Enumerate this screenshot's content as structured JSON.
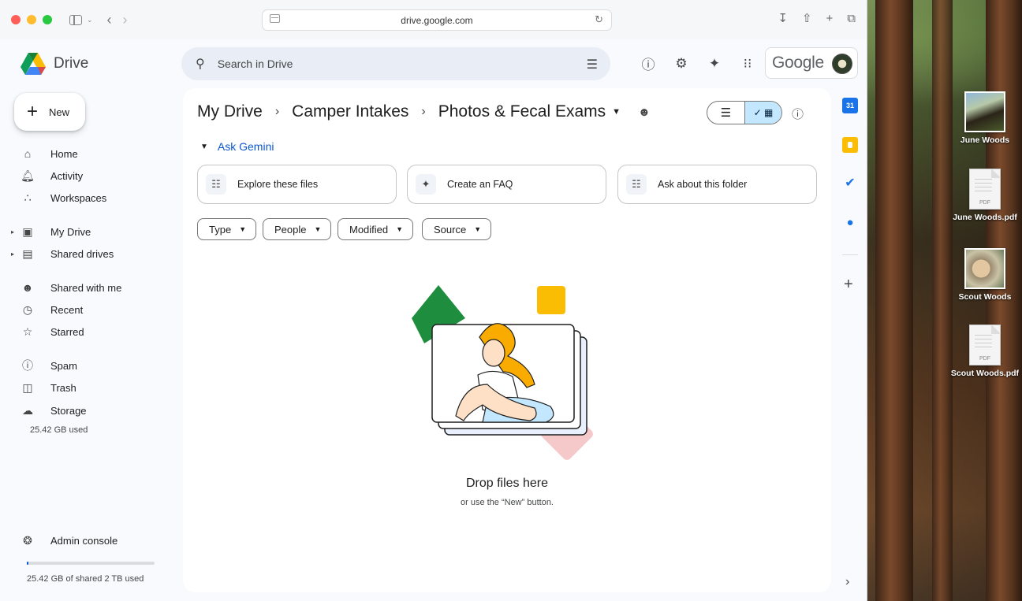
{
  "browser": {
    "url": "drive.google.com"
  },
  "header": {
    "app_name": "Drive",
    "search_placeholder": "Search in Drive",
    "google_word": "Google"
  },
  "leftnav": {
    "new_label": "New",
    "items_group1": [
      {
        "label": "Home",
        "icon": "home-icon"
      },
      {
        "label": "Activity",
        "icon": "bell-icon"
      },
      {
        "label": "Workspaces",
        "icon": "workspaces-icon"
      }
    ],
    "items_group2": [
      {
        "label": "My Drive",
        "icon": "drive-icon"
      },
      {
        "label": "Shared drives",
        "icon": "shared-drives-icon"
      }
    ],
    "items_group3": [
      {
        "label": "Shared with me",
        "icon": "people-icon"
      },
      {
        "label": "Recent",
        "icon": "clock-icon"
      },
      {
        "label": "Starred",
        "icon": "star-icon"
      }
    ],
    "items_group4": [
      {
        "label": "Spam",
        "icon": "spam-icon"
      },
      {
        "label": "Trash",
        "icon": "trash-icon"
      },
      {
        "label": "Storage",
        "icon": "cloud-icon"
      }
    ],
    "storage_used": "25.42 GB used",
    "admin_console": "Admin console",
    "quota_text": "25.42 GB of shared 2 TB used",
    "quota_fraction": 0.0127
  },
  "main": {
    "breadcrumb": [
      "My Drive",
      "Camper Intakes",
      "Photos & Fecal Exams"
    ],
    "ask_gemini": "Ask Gemini",
    "suggestions": [
      "Explore these files",
      "Create an FAQ",
      "Ask about this folder"
    ],
    "filters": [
      "Type",
      "People",
      "Modified",
      "Source"
    ],
    "empty_title": "Drop files here",
    "empty_subtitle": "or use the “New” button."
  },
  "desktop": {
    "items": [
      "June Woods",
      "June Woods.pdf",
      "Scout Woods",
      "Scout Woods.pdf"
    ]
  },
  "colors": {
    "accent": "#0b57d0",
    "selected_view": "#c2e7ff",
    "search_bg": "#e9eef6"
  }
}
